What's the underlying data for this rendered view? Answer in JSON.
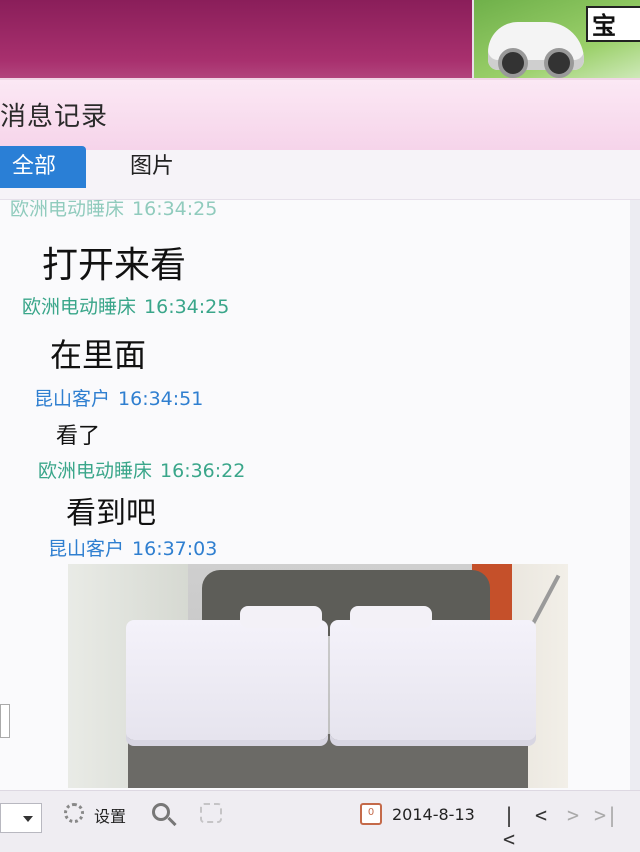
{
  "window": {
    "title": "消息记录"
  },
  "tabs": [
    {
      "label": "全部",
      "active": true
    },
    {
      "label": "图片",
      "active": false
    }
  ],
  "messages": [
    {
      "sender": "欧洲电动睡床",
      "time": "16:34:25",
      "text": "打开来看",
      "role": "seller",
      "partial_header": true
    },
    {
      "sender": "欧洲电动睡床",
      "time": "16:34:25",
      "text": "在里面",
      "role": "seller"
    },
    {
      "sender": "昆山客户",
      "time": "16:34:51",
      "text": "看了",
      "role": "customer"
    },
    {
      "sender": "欧洲电动睡床",
      "time": "16:36:22",
      "text": "看到吧",
      "role": "seller"
    },
    {
      "sender": "昆山客户",
      "time": "16:37:03",
      "text": "",
      "role": "customer",
      "has_image": true
    }
  ],
  "toolbar": {
    "settings_label": "设置",
    "date": "2014-8-13",
    "calendar_day": "0",
    "nav_first": "|<",
    "nav_prev": "<",
    "nav_next": ">",
    "nav_last": ">|"
  },
  "ad": {
    "text": "宝"
  },
  "colors": {
    "seller_header": "#3aa68a",
    "customer_header": "#2f7fd0",
    "active_tab": "#2a7fd6",
    "title_bar": "#f6d4ea"
  },
  "icons": [
    "gear-icon",
    "search-icon",
    "speaker-icon",
    "calendar-icon"
  ]
}
